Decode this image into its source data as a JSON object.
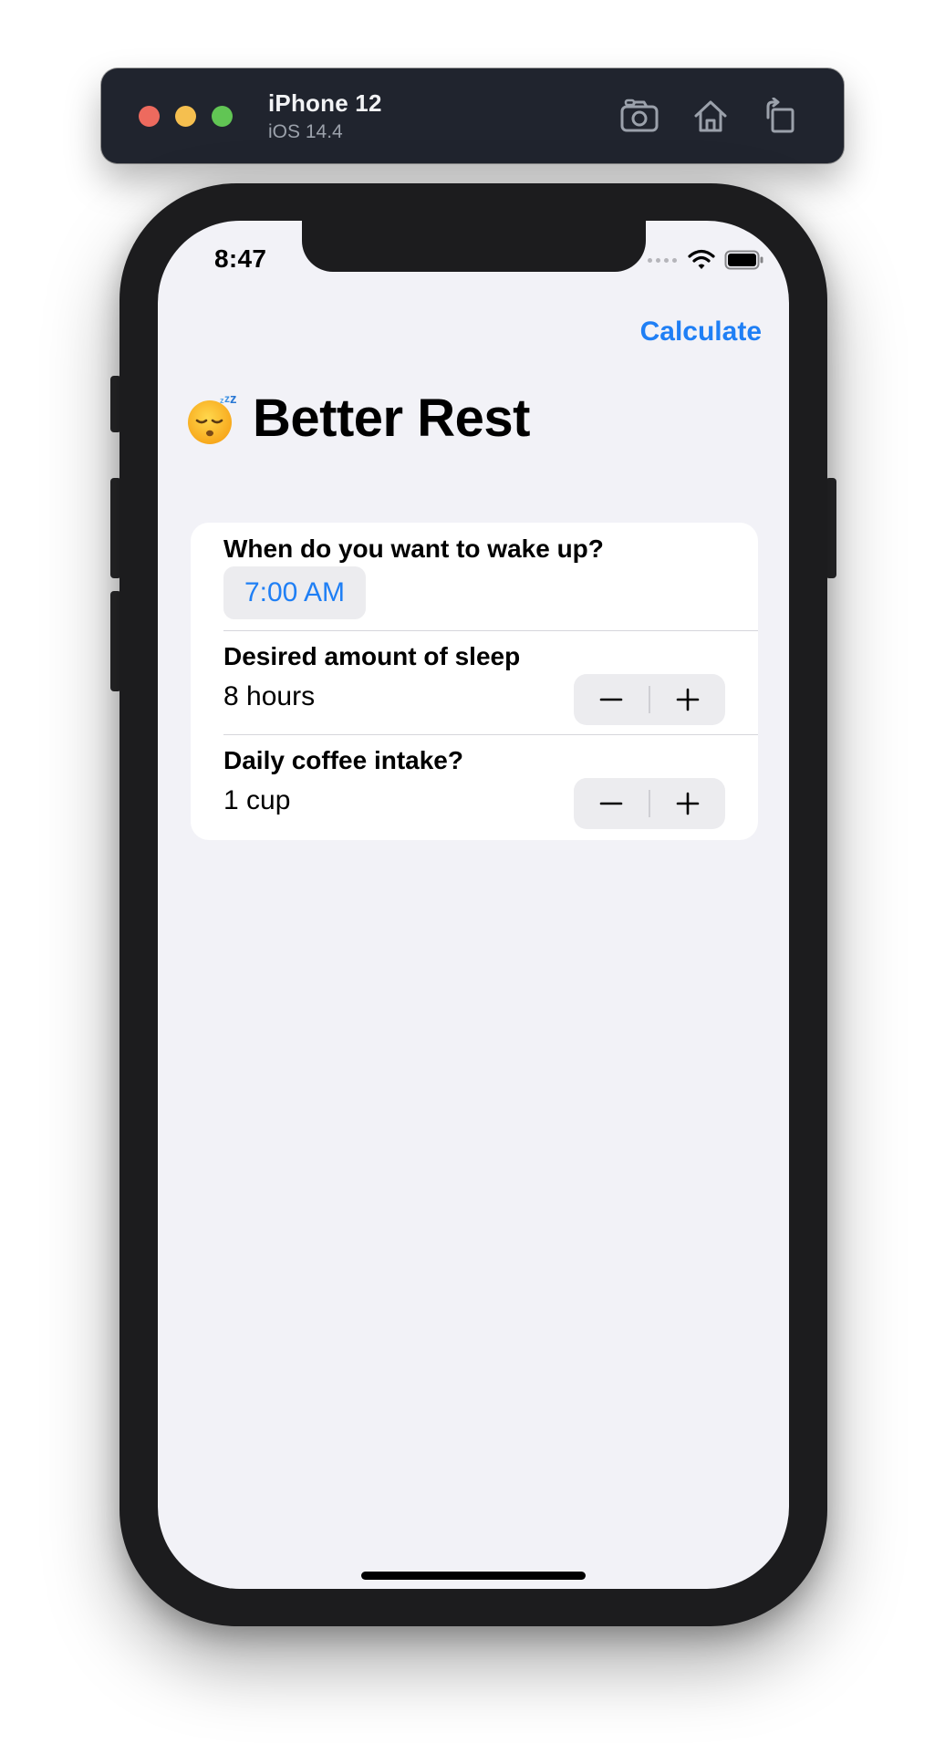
{
  "simulator": {
    "device_name": "iPhone 12",
    "os_version": "iOS 14.4",
    "toolbar_icons": [
      "camera-icon",
      "home-icon",
      "rotate-icon"
    ]
  },
  "status_bar": {
    "time": "8:47",
    "icons": [
      "cellular-icon",
      "wifi-icon",
      "battery-icon"
    ]
  },
  "nav": {
    "calculate_label": "Calculate",
    "title": "Better Rest",
    "title_icon": "sleeping-face-emoji-icon"
  },
  "form": {
    "wake_up": {
      "label": "When do you want to wake up?",
      "value": "7:00 AM"
    },
    "sleep_amount": {
      "label": "Desired amount of sleep",
      "value": "8 hours"
    },
    "coffee_intake": {
      "label": "Daily coffee intake?",
      "value": "1 cup"
    }
  },
  "colors": {
    "accent": "#1f7ff5",
    "background": "#f2f2f7",
    "card": "#ffffff",
    "sim_bar": "#20242e"
  }
}
